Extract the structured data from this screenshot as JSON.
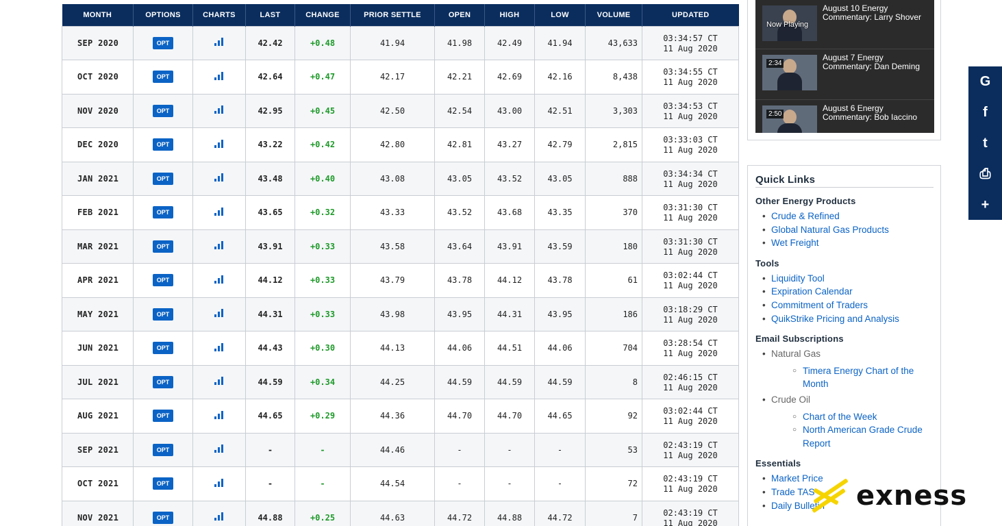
{
  "table": {
    "headers": [
      "MONTH",
      "OPTIONS",
      "CHARTS",
      "LAST",
      "CHANGE",
      "PRIOR SETTLE",
      "OPEN",
      "HIGH",
      "LOW",
      "VOLUME",
      "UPDATED"
    ],
    "opt_label": "OPT",
    "rows": [
      {
        "month": "SEP 2020",
        "last": "42.42",
        "change": "+0.48",
        "prior": "41.94",
        "open": "41.98",
        "high": "42.49",
        "low": "41.94",
        "volume": "43,633",
        "time": "03:34:57 CT",
        "date": "11 Aug 2020"
      },
      {
        "month": "OCT 2020",
        "last": "42.64",
        "change": "+0.47",
        "prior": "42.17",
        "open": "42.21",
        "high": "42.69",
        "low": "42.16",
        "volume": "8,438",
        "time": "03:34:55 CT",
        "date": "11 Aug 2020"
      },
      {
        "month": "NOV 2020",
        "last": "42.95",
        "change": "+0.45",
        "prior": "42.50",
        "open": "42.54",
        "high": "43.00",
        "low": "42.51",
        "volume": "3,303",
        "time": "03:34:53 CT",
        "date": "11 Aug 2020"
      },
      {
        "month": "DEC 2020",
        "last": "43.22",
        "change": "+0.42",
        "prior": "42.80",
        "open": "42.81",
        "high": "43.27",
        "low": "42.79",
        "volume": "2,815",
        "time": "03:33:03 CT",
        "date": "11 Aug 2020"
      },
      {
        "month": "JAN 2021",
        "last": "43.48",
        "change": "+0.40",
        "prior": "43.08",
        "open": "43.05",
        "high": "43.52",
        "low": "43.05",
        "volume": "888",
        "time": "03:34:34 CT",
        "date": "11 Aug 2020"
      },
      {
        "month": "FEB 2021",
        "last": "43.65",
        "change": "+0.32",
        "prior": "43.33",
        "open": "43.52",
        "high": "43.68",
        "low": "43.35",
        "volume": "370",
        "time": "03:31:30 CT",
        "date": "11 Aug 2020"
      },
      {
        "month": "MAR 2021",
        "last": "43.91",
        "change": "+0.33",
        "prior": "43.58",
        "open": "43.64",
        "high": "43.91",
        "low": "43.59",
        "volume": "180",
        "time": "03:31:30 CT",
        "date": "11 Aug 2020"
      },
      {
        "month": "APR 2021",
        "last": "44.12",
        "change": "+0.33",
        "prior": "43.79",
        "open": "43.78",
        "high": "44.12",
        "low": "43.78",
        "volume": "61",
        "time": "03:02:44 CT",
        "date": "11 Aug 2020"
      },
      {
        "month": "MAY 2021",
        "last": "44.31",
        "change": "+0.33",
        "prior": "43.98",
        "open": "43.95",
        "high": "44.31",
        "low": "43.95",
        "volume": "186",
        "time": "03:18:29 CT",
        "date": "11 Aug 2020"
      },
      {
        "month": "JUN 2021",
        "last": "44.43",
        "change": "+0.30",
        "prior": "44.13",
        "open": "44.06",
        "high": "44.51",
        "low": "44.06",
        "volume": "704",
        "time": "03:28:54 CT",
        "date": "11 Aug 2020"
      },
      {
        "month": "JUL 2021",
        "last": "44.59",
        "change": "+0.34",
        "prior": "44.25",
        "open": "44.59",
        "high": "44.59",
        "low": "44.59",
        "volume": "8",
        "time": "02:46:15 CT",
        "date": "11 Aug 2020"
      },
      {
        "month": "AUG 2021",
        "last": "44.65",
        "change": "+0.29",
        "prior": "44.36",
        "open": "44.70",
        "high": "44.70",
        "low": "44.65",
        "volume": "92",
        "time": "03:02:44 CT",
        "date": "11 Aug 2020"
      },
      {
        "month": "SEP 2021",
        "last": "-",
        "change": "-",
        "prior": "44.46",
        "open": "-",
        "high": "-",
        "low": "-",
        "volume": "53",
        "time": "02:43:19 CT",
        "date": "11 Aug 2020"
      },
      {
        "month": "OCT 2021",
        "last": "-",
        "change": "-",
        "prior": "44.54",
        "open": "-",
        "high": "-",
        "low": "-",
        "volume": "72",
        "time": "02:43:19 CT",
        "date": "11 Aug 2020"
      },
      {
        "month": "NOV 2021",
        "last": "44.88",
        "change": "+0.25",
        "prior": "44.63",
        "open": "44.72",
        "high": "44.88",
        "low": "44.72",
        "volume": "7",
        "time": "02:43:19 CT",
        "date": "11 Aug 2020"
      }
    ]
  },
  "videos": [
    {
      "badge": "",
      "now_playing": "Now Playing",
      "title": "August 10 Energy Commentary: Larry Shover"
    },
    {
      "badge": "2:34",
      "now_playing": "",
      "title": "August 7 Energy Commentary: Dan Deming"
    },
    {
      "badge": "2:50",
      "now_playing": "",
      "title": "August 6 Energy Commentary: Bob Iaccino"
    }
  ],
  "share_icons": [
    "google-icon",
    "facebook-icon",
    "twitter-icon",
    "print-icon",
    "plus-icon"
  ],
  "share_glyphs": [
    "G",
    "f",
    "t",
    "⎙",
    "+"
  ],
  "quick_links": {
    "title": "Quick Links",
    "other_energy": {
      "heading": "Other Energy Products",
      "links": [
        "Crude & Refined",
        "Global Natural Gas Products",
        "Wet Freight"
      ]
    },
    "tools": {
      "heading": "Tools",
      "links": [
        "Liquidity Tool",
        "Expiration Calendar",
        "Commitment of Traders",
        "QuikStrike Pricing and Analysis"
      ]
    },
    "email": {
      "heading": "Email Subscriptions",
      "natural_gas": {
        "label": "Natural Gas",
        "links": [
          "Timera Energy Chart of the Month"
        ]
      },
      "crude_oil": {
        "label": "Crude Oil",
        "links": [
          "Chart of the Week",
          "North American Grade Crude Report"
        ]
      }
    },
    "essentials": {
      "heading": "Essentials",
      "links": [
        "Market Price",
        "Trade TAS",
        "Daily Bulletin"
      ]
    }
  },
  "watermark": {
    "text": "exness",
    "color": "#f5d400"
  },
  "colors": {
    "header_bg": "#0a2d5e",
    "link": "#0b63c5",
    "positive_change": "#1f9a2a"
  }
}
